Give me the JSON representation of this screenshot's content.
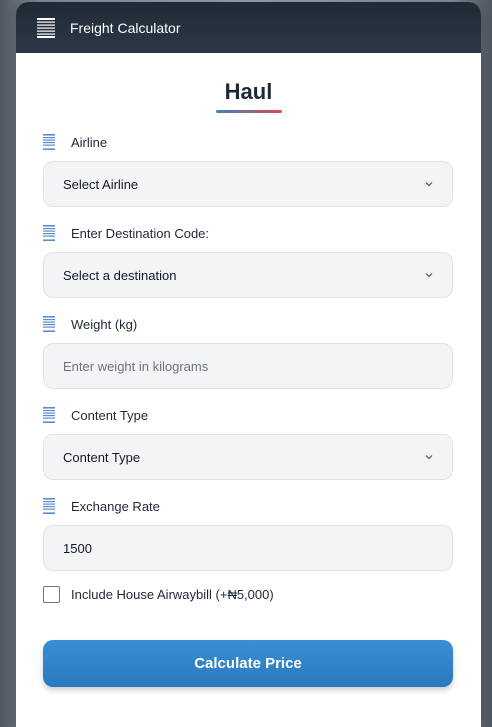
{
  "app": {
    "title": "Freight Calculator"
  },
  "brand": {
    "title": "Haul"
  },
  "fields": {
    "airline": {
      "label": "Airline",
      "value": "Select Airline"
    },
    "destination": {
      "label": "Enter Destination Code:",
      "value": "Select a destination"
    },
    "weight": {
      "label": "Weight (kg)",
      "placeholder": "Enter weight in kilograms"
    },
    "content_type": {
      "label": "Content Type",
      "value": "Content Type"
    },
    "exchange_rate": {
      "label": "Exchange Rate",
      "value": "1500"
    }
  },
  "house_airwaybill": {
    "label": "Include House Airwaybill (+₦5,000)",
    "checked": false
  },
  "actions": {
    "calculate_label": "Calculate Price"
  },
  "colors": {
    "titlebar": "#1f2a36",
    "accent_blue": "#3a8fd4",
    "underline_start": "#3b82c4",
    "underline_end": "#e24a4a",
    "field_icon": "#5b8bd0"
  },
  "icons": {
    "title": "menu-lines-icon",
    "field": "list-lines-icon",
    "select": "chevron-down-icon"
  }
}
